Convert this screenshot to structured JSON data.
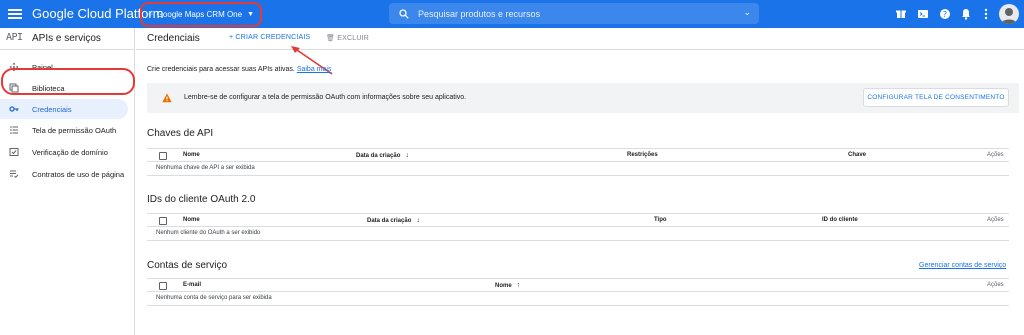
{
  "header": {
    "brand": "Google Cloud Platform",
    "project": "Google Maps CRM One",
    "search_placeholder": "Pesquisar produtos e recursos"
  },
  "sidebar": {
    "logo": "API",
    "title": "APIs e serviços",
    "items": [
      {
        "label": "Painel",
        "icon": "dashboard-icon"
      },
      {
        "label": "Biblioteca",
        "icon": "library-icon"
      },
      {
        "label": "Credenciais",
        "icon": "key-icon",
        "active": true
      },
      {
        "label": "Tela de permissão OAuth",
        "icon": "consent-icon"
      },
      {
        "label": "Verificação de domínio",
        "icon": "domain-check-icon"
      },
      {
        "label": "Contratos de uso de página",
        "icon": "agreements-icon"
      }
    ]
  },
  "main": {
    "title": "Credenciais",
    "create_label": "+ CRIAR CREDENCIAIS",
    "delete_label": "EXCLUIR",
    "intro_text": "Crie credenciais para acessar suas APIs ativas.",
    "intro_link": "Saiba mais",
    "alert_text": "Lembre-se de configurar a tela de permissão OAuth com informações sobre seu aplicativo.",
    "alert_button": "CONFIGURAR TELA DE CONSENTIMENTO"
  },
  "api_keys": {
    "title": "Chaves de API",
    "columns": [
      "Nome",
      "Data da criação",
      "Restrições",
      "Chave",
      "Ações"
    ],
    "empty": "Nenhuma chave de API a ser exibida"
  },
  "oauth": {
    "title": "IDs do cliente OAuth 2.0",
    "columns": [
      "Nome",
      "Data da criação",
      "Tipo",
      "ID do cliente",
      "Ações"
    ],
    "empty": "Nenhum cliente do OAuth a ser exibido"
  },
  "service_accounts": {
    "title": "Contas de serviço",
    "manage_link": "Gerenciar contas de serviço",
    "columns": [
      "E-mail",
      "Nome",
      "Ações"
    ],
    "empty": "Nenhuma conta de serviço para ser exibida"
  },
  "colors": {
    "primary": "#1a73e8",
    "highlight": "#e53935",
    "warning": "#e37400",
    "active_bg": "#e8f0fe"
  }
}
